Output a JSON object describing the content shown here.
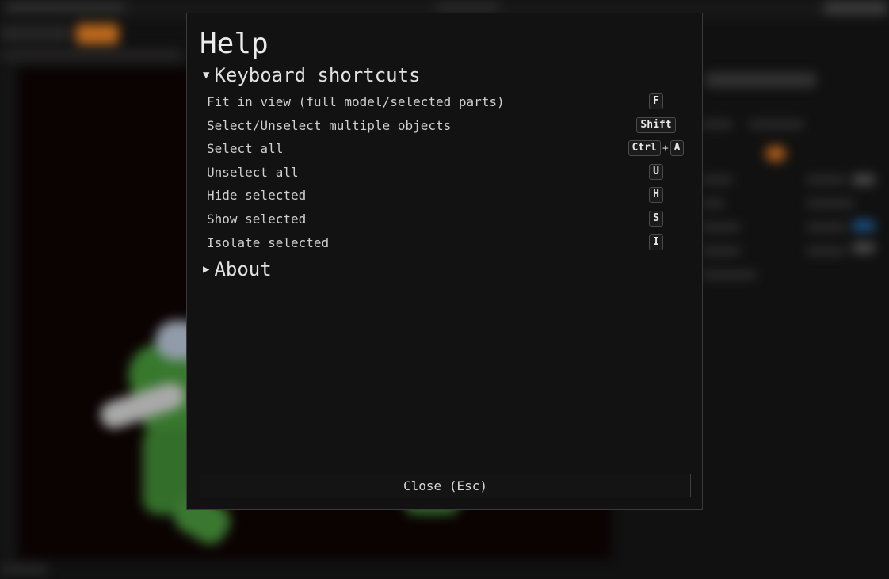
{
  "modal": {
    "title": "Help",
    "close_label": "Close (Esc)"
  },
  "sections": {
    "keyboard": {
      "title": "Keyboard shortcuts",
      "expanded": true,
      "arrow": "▼",
      "shortcuts": [
        {
          "label": "Fit in view (full model/selected parts)",
          "keys": [
            "F"
          ]
        },
        {
          "label": "Select/Unselect multiple objects",
          "keys": [
            "Shift"
          ]
        },
        {
          "label": "Select all",
          "keys": [
            "Ctrl",
            "A"
          ],
          "separator": "+"
        },
        {
          "label": "Unselect all",
          "keys": [
            "U"
          ]
        },
        {
          "label": "Hide selected",
          "keys": [
            "H"
          ]
        },
        {
          "label": "Show selected",
          "keys": [
            "S"
          ]
        },
        {
          "label": "Isolate selected",
          "keys": [
            "I"
          ]
        }
      ]
    },
    "about": {
      "title": "About",
      "expanded": false,
      "arrow": "▶"
    }
  },
  "colors": {
    "background": "#111111",
    "modal_bg": "#121212",
    "accent_orange": "#d9771f",
    "model_green": "#3f8a33"
  }
}
